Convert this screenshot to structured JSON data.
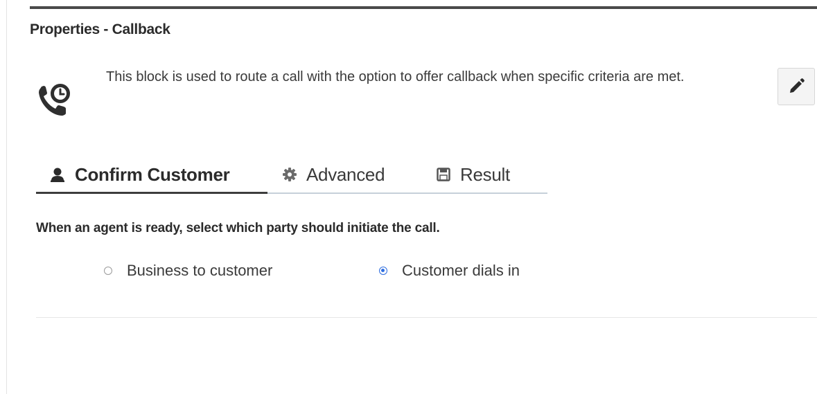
{
  "panel": {
    "title": "Properties - Callback",
    "description": "This block is used to route a call with the option to offer callback when specific criteria are met.",
    "edit_icon": "pencil-icon",
    "block_icon": "phone-clock-icon"
  },
  "tabs": [
    {
      "label": "Confirm Customer",
      "icon": "user-icon",
      "active": true
    },
    {
      "label": "Advanced",
      "icon": "gear-icon",
      "active": false
    },
    {
      "label": "Result",
      "icon": "save-icon",
      "active": false
    }
  ],
  "confirm_customer": {
    "prompt": "When an agent is ready, select which party should initiate the call.",
    "options": [
      {
        "label": "Business to customer",
        "checked": false
      },
      {
        "label": "Customer dials in",
        "checked": true
      }
    ]
  },
  "colors": {
    "accent": "#2f6ee0",
    "tab_underline": "#c6d0d9",
    "active_tab_line": "#3d3d3d"
  }
}
